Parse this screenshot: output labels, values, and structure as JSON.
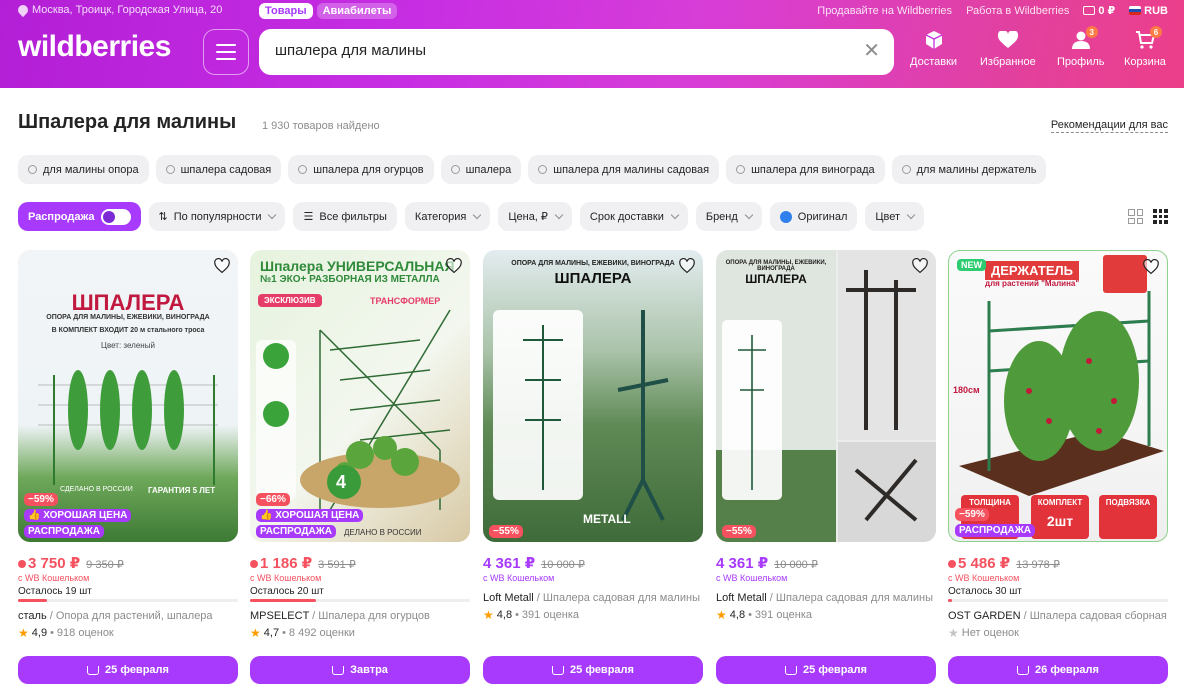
{
  "header": {
    "location": "Москва, Троицк, Городская Улица, 20",
    "tabs": [
      "Товары",
      "Авиабилеты"
    ],
    "links": [
      "Продавайте на Wildberries",
      "Работа в Wildberries"
    ],
    "wallet_balance": "0 ₽",
    "currency": "RUB",
    "logo": "wildberries",
    "search_value": "шпалера для малины",
    "nav": [
      {
        "label": "Доставки",
        "icon": "box-icon"
      },
      {
        "label": "Избранное",
        "icon": "heart-icon"
      },
      {
        "label": "Профиль",
        "icon": "user-icon",
        "badge": "3"
      },
      {
        "label": "Корзина",
        "icon": "cart-icon",
        "badge": "6"
      }
    ]
  },
  "page": {
    "title": "Шпалера для малины",
    "count": "1 930 товаров найдено",
    "recommend": "Рекомендации для вас"
  },
  "suggest": [
    "для малины опора",
    "шпалера садовая",
    "шпалера для огурцов",
    "шпалера",
    "шпалера для малины садовая",
    "шпалера для винограда",
    "для малины держатель"
  ],
  "filters": {
    "sale": "Распродажа",
    "sort": "По популярности",
    "all": "Все фильтры",
    "items": [
      "Категория",
      "Цена, ₽",
      "Срок доставки",
      "Бренд"
    ],
    "original": "Оригинал",
    "color": "Цвет"
  },
  "products": [
    {
      "price": "3 750 ₽",
      "old": "9 350 ₽",
      "wallet": "с WB Кошельком",
      "left": "Осталось 19 шт",
      "left_fraction": 0.13,
      "brand": "сталь",
      "name": " / Опора для растений, шпалера",
      "rating": "4,9",
      "reviews": "918 оценок",
      "discount": "−59%",
      "good": "ХОРОШАЯ ЦЕНА",
      "sale": "РАСПРОДАЖА",
      "delivery": "25 февраля",
      "img": {
        "title": "ШПАЛЕРА",
        "sub": "ОПОРА ДЛЯ МАЛИНЫ, ЕЖЕВИКИ, ВИНОГРАДА",
        "kit": "В КОМПЛЕКТ ВХОДИТ 20 м стального троса",
        "color": "Цвет: зеленый",
        "made": "СДЕЛАНО В РОССИИ",
        "warranty": "ГАРАНТИЯ 5 ЛЕТ"
      }
    },
    {
      "price": "1 186 ₽",
      "old": "3 591 ₽",
      "wallet": "с WB Кошельком",
      "left": "Осталось 20 шт",
      "left_fraction": 0.3,
      "brand": "MPSELECT",
      "name": " / Шпалера для огурцов",
      "rating": "4,7",
      "reviews": "8 492 оценки",
      "discount": "−66%",
      "good": "ХОРОШАЯ ЦЕНА",
      "sale": "РАСПРОДАЖА",
      "delivery": "Завтра",
      "img": {
        "title": "Шпалера УНИВЕРСАЛЬНАЯ",
        "sub": "№1 ЭКО+ РАЗБОРНАЯ ИЗ МЕТАЛЛА",
        "excl": "ЭКСКЛЮЗИВ",
        "trans": "ТРАНСФОРМЕР",
        "sections": "4",
        "made": "ДЕЛАНО В РОССИИ"
      }
    },
    {
      "price": "4 361 ₽",
      "old": "10 000 ₽",
      "wallet": "с WB Кошельком",
      "brand": "Loft Metall",
      "name": " / Шпалера садовая для малины",
      "rating": "4,8",
      "reviews": "391 оценка",
      "discount": "−55%",
      "delivery": "25 февраля",
      "img": {
        "title": "ШПАЛЕРА",
        "sub": "ОПОРА ДЛЯ МАЛИНЫ, ЕЖЕВИКИ, ВИНОГРАДА",
        "brandmark": "METALL"
      }
    },
    {
      "price": "4 361 ₽",
      "old": "10 000 ₽",
      "wallet": "с WB Кошельком",
      "brand": "Loft Metall",
      "name": " / Шпалера садовая для малины",
      "rating": "4,8",
      "reviews": "391 оценка",
      "discount": "−55%",
      "delivery": "25 февраля",
      "img": {
        "title": "ШПАЛЕРА",
        "sub": "ОПОРА ДЛЯ МАЛИНЫ, ЕЖЕВИКИ, ВИНОГРАДА"
      }
    },
    {
      "price": "5 486 ₽",
      "old": "13 978 ₽",
      "wallet": "с WB Кошельком",
      "left": "Осталось 30 шт",
      "left_fraction": 0.02,
      "brand": "OST GARDEN",
      "name": " / Шпалера садовая сборная",
      "rating_note": "Нет оценок",
      "discount": "−59%",
      "sale": "РАСПРОДАЖА",
      "new": "NEW",
      "delivery": "26 февраля",
      "img": {
        "title": "ДЕРЖАТЕЛЬ",
        "sub": "для растений \"Малина\"",
        "height": "180см",
        "thick": "ТОЛЩИНА",
        "kit": "КОМПЛЕКТ",
        "two": "2шт",
        "gift": "ПОДВЯЗКА"
      }
    }
  ],
  "colors": {
    "accent": "#a73afd",
    "discount": "#f5515f",
    "star": "#ff9d00"
  }
}
